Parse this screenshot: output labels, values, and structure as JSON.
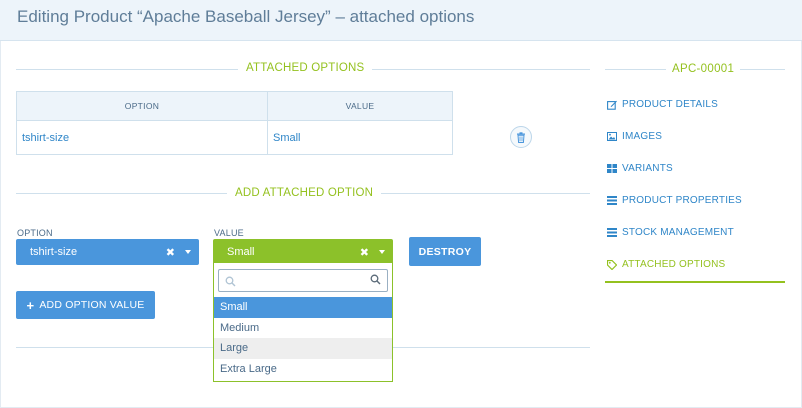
{
  "page": {
    "title": "Editing Product “Apache Baseball Jersey” – attached options"
  },
  "attached": {
    "section_title": "ATTACHED OPTIONS",
    "table": {
      "headers": [
        "OPTION",
        "VALUE"
      ],
      "rows": [
        {
          "option": "tshirt-size",
          "value": "Small"
        }
      ]
    }
  },
  "add": {
    "section_title": "ADD ATTACHED OPTION",
    "option_label": "OPTION",
    "value_label": "VALUE",
    "option_selected": "tshirt-size",
    "value_selected": "Small",
    "destroy_label": "DESTROY",
    "add_label": "ADD OPTION VALUE",
    "dropdown": {
      "search_value": "",
      "items": [
        "Small",
        "Medium",
        "Large",
        "Extra Large"
      ],
      "selected": "Small",
      "hovered": "Large"
    }
  },
  "sidebar": {
    "code": "APC-00001",
    "items": [
      {
        "label": "PRODUCT DETAILS",
        "icon": "edit-icon"
      },
      {
        "label": "IMAGES",
        "icon": "image-icon"
      },
      {
        "label": "VARIANTS",
        "icon": "grid-icon"
      },
      {
        "label": "PRODUCT PROPERTIES",
        "icon": "list-icon"
      },
      {
        "label": "STOCK MANAGEMENT",
        "icon": "list-icon"
      },
      {
        "label": "ATTACHED OPTIONS",
        "icon": "tag-icon",
        "active": true
      }
    ]
  },
  "colors": {
    "accent_green": "#94c11f",
    "link_blue": "#2f86c8",
    "button_blue": "#4a96dc",
    "select_green": "#8cc12a"
  }
}
